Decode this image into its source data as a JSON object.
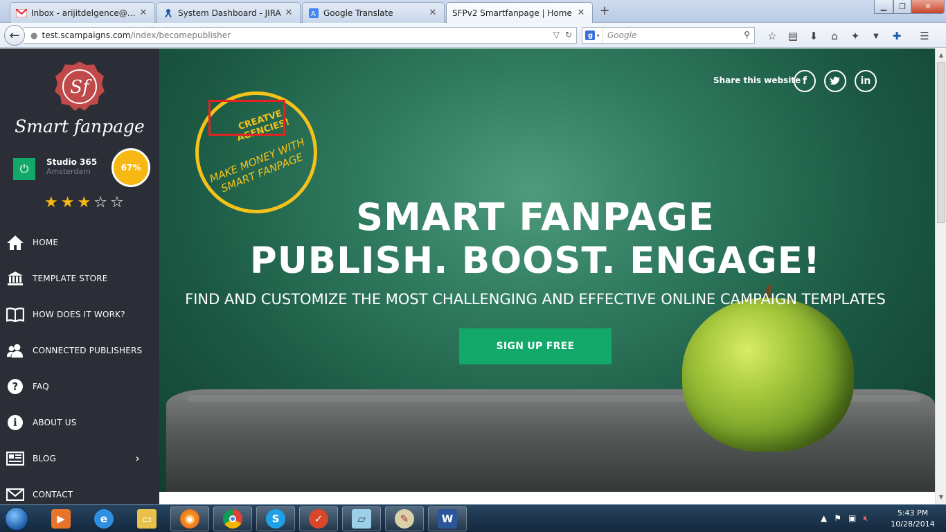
{
  "browser": {
    "tabs": [
      {
        "title": "Inbox - arijitdelgence@gm...",
        "icon": "gmail-icon"
      },
      {
        "title": "System Dashboard - JIRA",
        "icon": "jira-icon"
      },
      {
        "title": "Google Translate",
        "icon": "translate-icon"
      },
      {
        "title": "SFPv2 Smartfanpage | Home",
        "icon": "none"
      }
    ],
    "url_host": "test.scampaigns.com",
    "url_path": "/index/becomepublisher",
    "search_placeholder": "Google"
  },
  "sidebar": {
    "logo_text": "Smart fanpage",
    "profile_name": "Studio 365",
    "profile_city": "Amsterdam",
    "completion": "67%",
    "rating": {
      "value": 3,
      "max": 5
    },
    "menu": [
      {
        "label": "HOME",
        "icon": "home-icon"
      },
      {
        "label": "TEMPLATE STORE",
        "icon": "bank-icon"
      },
      {
        "label": "HOW DOES IT WORK?",
        "icon": "book-icon"
      },
      {
        "label": "CONNECTED PUBLISHERS",
        "icon": "users-icon"
      },
      {
        "label": "FAQ",
        "icon": "question-icon"
      },
      {
        "label": "ABOUT US",
        "icon": "info-icon"
      },
      {
        "label": "BLOG",
        "icon": "newspaper-icon"
      },
      {
        "label": "CONTACT",
        "icon": "envelope-icon"
      }
    ]
  },
  "hero": {
    "share_label": "Share this website",
    "promo_line1": "CREATVE AGENCIES!",
    "promo_line2": "MAKE MONEY WITH SMART FANPAGE",
    "headline1": "SMART FANPAGE",
    "headline2": "PUBLISH. BOOST. ENGAGE!",
    "subheadline": "FIND AND CUSTOMIZE THE MOST CHALLENGING AND EFFECTIVE ONLINE CAMPAIGN TEMPLATES",
    "cta_label": "SIGN UP FREE"
  },
  "taskbar": {
    "time": "5:43 PM",
    "date": "10/28/2014"
  },
  "colors": {
    "sidebar_bg": "#2b2e36",
    "accent_green": "#12a86a",
    "badge_yellow": "#f7b813",
    "promo_yellow": "#f5c21a"
  }
}
